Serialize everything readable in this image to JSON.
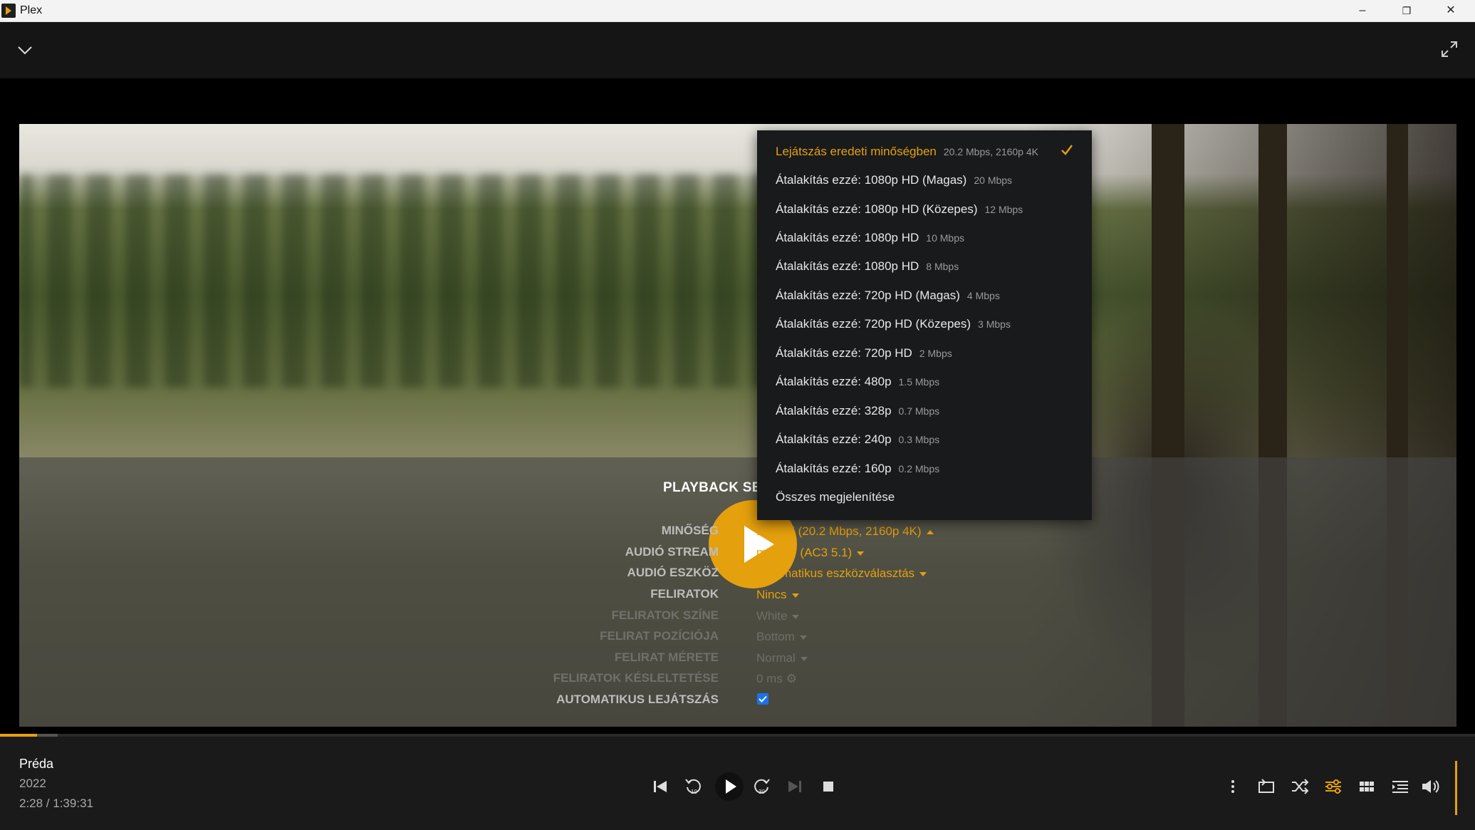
{
  "window": {
    "title": "Plex",
    "minimize": "–",
    "restore": "❐",
    "close": "✕"
  },
  "player": {
    "big_play_icon": "play-icon",
    "settings": {
      "title": "PLAYBACK SE",
      "rows": [
        {
          "label": "MINŐSÉG",
          "value": "Eredeti (20.2 Mbps, 2160p 4K)"
        },
        {
          "label": "AUDIÓ STREAM",
          "value": "magyar (AC3 5.1)"
        },
        {
          "label": "AUDIÓ ESZKÖZ",
          "value": "Automatikus eszközválasztás"
        },
        {
          "label": "FELIRATOK",
          "value": "Nincs"
        },
        {
          "label": "FELIRATOK SZÍNE",
          "value": "White"
        },
        {
          "label": "FELIRAT POZÍCIÓJA",
          "value": "Bottom"
        },
        {
          "label": "FELIRAT MÉRETE",
          "value": "Normal"
        },
        {
          "label": "FELIRATOK KÉSLELTETÉSE",
          "value": "0 ms"
        },
        {
          "label": "AUTOMATIKUS LEJÁTSZÁS",
          "value": ""
        }
      ],
      "autoplay_checked": true
    },
    "quality_menu": [
      {
        "label": "Lejátszás eredeti minőségben",
        "sub": "20.2 Mbps, 2160p 4K"
      },
      {
        "label": "Átalakítás ezzé: 1080p HD (Magas)",
        "sub": "20 Mbps"
      },
      {
        "label": "Átalakítás ezzé: 1080p HD (Közepes)",
        "sub": "12 Mbps"
      },
      {
        "label": "Átalakítás ezzé: 1080p HD",
        "sub": "10 Mbps"
      },
      {
        "label": "Átalakítás ezzé: 1080p HD",
        "sub": "8 Mbps"
      },
      {
        "label": "Átalakítás ezzé: 720p HD (Magas)",
        "sub": "4 Mbps"
      },
      {
        "label": "Átalakítás ezzé: 720p HD (Közepes)",
        "sub": "3 Mbps"
      },
      {
        "label": "Átalakítás ezzé: 720p HD",
        "sub": "2 Mbps"
      },
      {
        "label": "Átalakítás ezzé: 480p",
        "sub": "1.5 Mbps"
      },
      {
        "label": "Átalakítás ezzé: 328p",
        "sub": "0.7 Mbps"
      },
      {
        "label": "Átalakítás ezzé: 240p",
        "sub": "0.3 Mbps"
      },
      {
        "label": "Átalakítás ezzé: 160p",
        "sub": "0.2 Mbps"
      },
      {
        "label": "Összes megjelenítése",
        "sub": ""
      }
    ],
    "quality_selected_index": 0,
    "progress": {
      "played_fraction": 0.025,
      "buffered_fraction": 0.039
    },
    "now_playing": {
      "title": "Préda",
      "year": "2022",
      "time": "2:28 / 1:39:31"
    },
    "accent_color": "#e5a00d"
  }
}
